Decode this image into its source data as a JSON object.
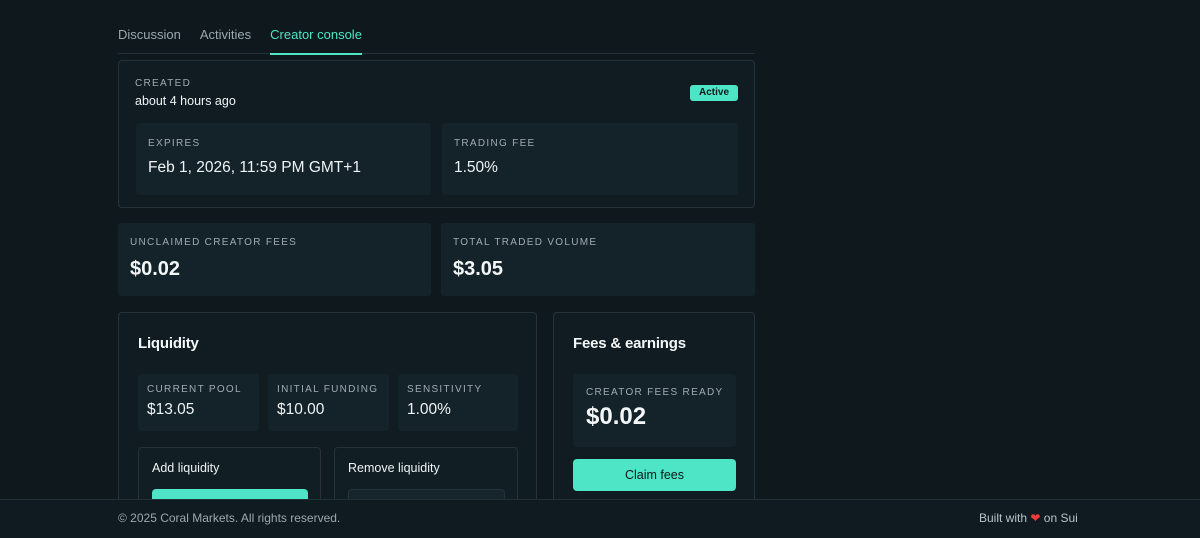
{
  "tabs": [
    {
      "label": "Discussion",
      "active": false
    },
    {
      "label": "Activities",
      "active": false
    },
    {
      "label": "Creator console",
      "active": true
    }
  ],
  "market": {
    "created_label": "CREATED",
    "created_value": "about 4 hours ago",
    "status": "Active",
    "expires_label": "EXPIRES",
    "expires_value": "Feb 1, 2026, 11:59 PM GMT+1",
    "trading_fee_label": "TRADING FEE",
    "trading_fee_value": "1.50%"
  },
  "stats": {
    "unclaimed_label": "UNCLAIMED CREATOR FEES",
    "unclaimed_value": "$0.02",
    "volume_label": "TOTAL TRADED VOLUME",
    "volume_value": "$3.05"
  },
  "liquidity": {
    "title": "Liquidity",
    "current_pool_label": "CURRENT POOL",
    "current_pool_value": "$13.05",
    "initial_funding_label": "INITIAL FUNDING",
    "initial_funding_value": "$10.00",
    "sensitivity_label": "SENSITIVITY",
    "sensitivity_value": "1.00%",
    "add_title": "Add liquidity",
    "remove_title": "Remove liquidity"
  },
  "fees": {
    "title": "Fees & earnings",
    "ready_label": "CREATOR FEES READY",
    "ready_value": "$0.02",
    "claim_button": "Claim fees"
  },
  "footer": {
    "copyright": "© 2025 Coral Markets. All rights reserved.",
    "built_prefix": "Built with",
    "built_suffix": "on Sui"
  },
  "colors": {
    "accent": "#4ee5c6",
    "background": "#0e181d",
    "card": "#101c22",
    "heart": "#ef3b3b"
  }
}
